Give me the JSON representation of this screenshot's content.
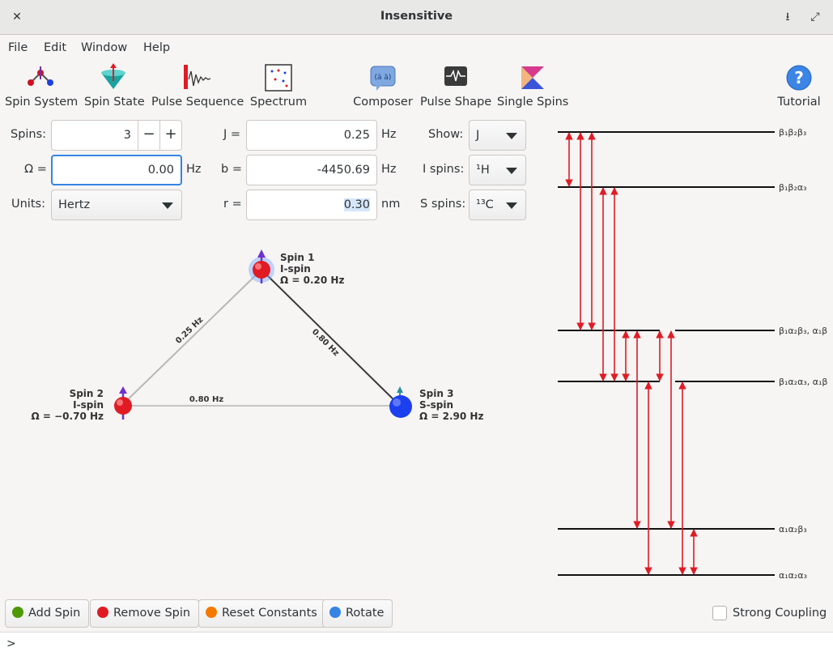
{
  "window": {
    "title": "Insensitive",
    "close_glyph": "✕",
    "minimize_glyph": "⭳",
    "maximize_glyph": "⤢"
  },
  "menu": [
    "File",
    "Edit",
    "Window",
    "Help"
  ],
  "toolbar": {
    "spin_system": "Spin System",
    "spin_state": "Spin State",
    "pulse_sequence": "Pulse Sequence",
    "spectrum": "Spectrum",
    "composer": "Composer",
    "pulse_shape": "Pulse Shape",
    "single_spins": "Single Spins",
    "tutorial": "Tutorial"
  },
  "controls": {
    "spins_label": "Spins:",
    "spins_value": "3",
    "minus": "−",
    "plus": "+",
    "omega_label": "Ω =",
    "omega_value": "0.00",
    "omega_unit": "Hz",
    "units_label": "Units:",
    "units_value": "Hertz",
    "j_label": "J =",
    "j_value": "0.25",
    "j_unit": "Hz",
    "b_label": "b =",
    "b_value": "-4450.69",
    "b_unit": "Hz",
    "r_label": "r =",
    "r_value": "0.30",
    "r_unit": "nm",
    "show_label": "Show:",
    "show_value": "J",
    "ispins_label": "I spins:",
    "ispins_value": "¹H",
    "sspins_label": "S spins:",
    "sspins_value": "¹³C"
  },
  "spins": [
    {
      "name": "Spin 1",
      "type": "I-spin",
      "omega": "Ω = 0.20 Hz"
    },
    {
      "name": "Spin 2",
      "type": "I-spin",
      "omega": "Ω = −0.70 Hz"
    },
    {
      "name": "Spin 3",
      "type": "S-spin",
      "omega": "Ω = 2.90 Hz"
    }
  ],
  "couplings": {
    "c12": "0.25 Hz",
    "c13": "0.80 Hz",
    "c23": "0.80 Hz"
  },
  "energy_levels": [
    "β₁β₂β₃",
    "β₁β₂α₃",
    "β₁α₂β₃, α₁β",
    "β₁α₂α₃, α₁β",
    "α₁α₂β₃",
    "α₁α₂α₃"
  ],
  "buttons": {
    "add_spin": "Add Spin",
    "remove_spin": "Remove Spin",
    "reset_constants": "Reset Constants",
    "rotate": "Rotate",
    "strong_coupling": "Strong Coupling"
  },
  "status": {
    "prompt": ">"
  },
  "colors": {
    "accent": "#3584e4",
    "transition": "#e01b24",
    "ispin": "#e01b24",
    "sspin": "#1c3ff0"
  }
}
